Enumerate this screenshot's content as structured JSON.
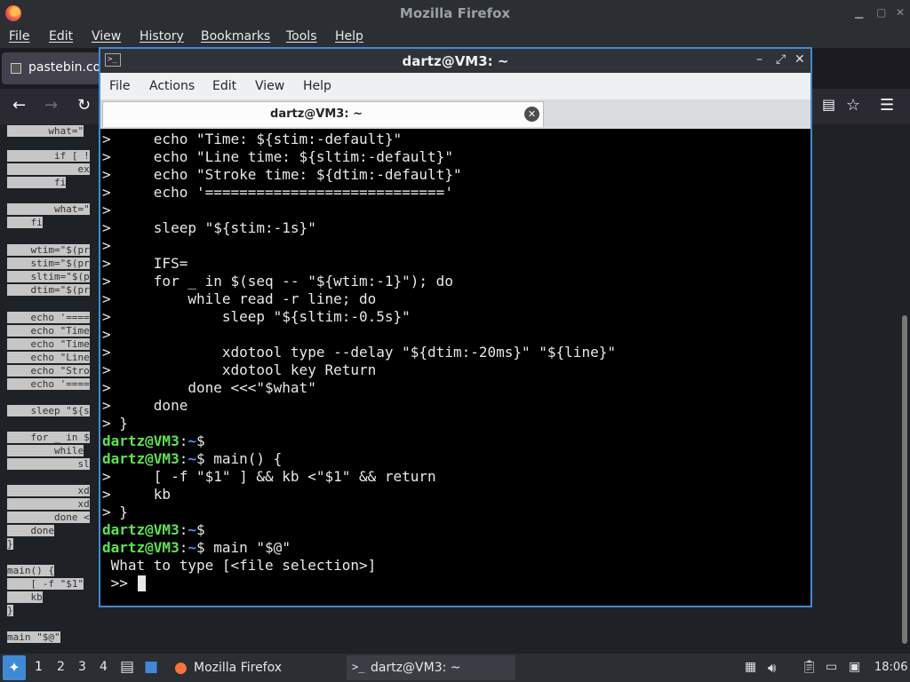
{
  "firefox": {
    "title": "Mozilla Firefox",
    "menu": [
      "File",
      "Edit",
      "View",
      "History",
      "Bookmarks",
      "Tools",
      "Help"
    ],
    "tab_label": "pastebin.co",
    "page_code_fragments": [
      "what=\"",
      "if [ !",
      "ex",
      "fi",
      "what=\"",
      "fi",
      "wtim=\"$(pr",
      "stim=\"$(pr",
      "sltim=\"$(p",
      "dtim=\"$(pr",
      "echo '====",
      "echo \"Time",
      "echo \"Time",
      "echo \"Line",
      "echo \"Stro",
      "echo '====",
      "sleep \"${s",
      "for _ in $",
      "while",
      "sl",
      "xd",
      "xd",
      "done <",
      "done",
      "}",
      "main() {",
      "[ -f \"$1\"",
      "kb",
      "}",
      "main \"$@\""
    ]
  },
  "terminal": {
    "title": "dartz@VM3: ~",
    "menu": [
      "File",
      "Actions",
      "Edit",
      "View",
      "Help"
    ],
    "tab_title": "dartz@VM3: ~",
    "prompt_user": "dartz@VM3",
    "prompt_sep": ":",
    "prompt_path": "~",
    "prompt_end": "$",
    "lines": [
      {
        "text": ">     echo \"Time: ${stim:-default}\""
      },
      {
        "text": ">     echo \"Line time: ${sltim:-default}\""
      },
      {
        "text": ">     echo \"Stroke time: ${dtim:-default}\""
      },
      {
        "text": ">     echo '============================'"
      },
      {
        "text": ">"
      },
      {
        "text": ">     sleep \"${stim:-1s}\""
      },
      {
        "text": ">"
      },
      {
        "text": ">     IFS="
      },
      {
        "text": ">     for _ in $(seq -- \"${wtim:-1}\"); do"
      },
      {
        "text": ">         while read -r line; do"
      },
      {
        "text": ">             sleep \"${sltim:-0.5s}\""
      },
      {
        "text": ">"
      },
      {
        "text": ">             xdotool type --delay \"${dtim:-20ms}\" \"${line}\""
      },
      {
        "text": ">             xdotool key Return"
      },
      {
        "text": ">         done <<<\"$what\""
      },
      {
        "text": ">     done"
      },
      {
        "text": "> }"
      },
      {
        "prompt": true,
        "cmd": ""
      },
      {
        "prompt": true,
        "cmd": " main() {"
      },
      {
        "text": ">     [ -f \"$1\" ] && kb <\"$1\" && return"
      },
      {
        "text": ">     kb"
      },
      {
        "text": "> }"
      },
      {
        "prompt": true,
        "cmd": ""
      },
      {
        "prompt": true,
        "cmd": " main \"$@\""
      },
      {
        "text": " What to type [<file selection>]"
      },
      {
        "text": " >> "
      }
    ]
  },
  "taskbar": {
    "workspaces": [
      "1",
      "2",
      "3",
      "4"
    ],
    "apps": [
      {
        "label": "Mozilla Firefox"
      },
      {
        "label": "dartz@VM3: ~"
      }
    ],
    "clock": "18:06"
  },
  "colors": {
    "terminal_border": "#3f8ad6",
    "prompt_user": "#5de34f",
    "prompt_path": "#5a8ef7"
  }
}
